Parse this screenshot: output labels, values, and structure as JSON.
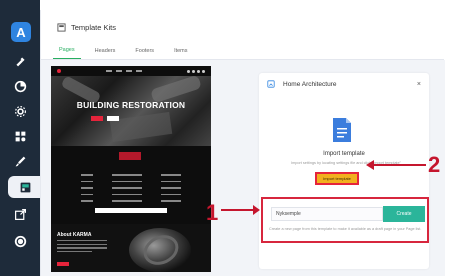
{
  "sidebar": {
    "logo_letter": "A",
    "items": [
      {
        "icon": "brush-icon"
      },
      {
        "icon": "pie-icon"
      },
      {
        "icon": "settings-icon"
      },
      {
        "icon": "blocks-icon"
      },
      {
        "icon": "paintbrush-icon"
      },
      {
        "icon": "template-icon",
        "active": true
      },
      {
        "icon": "export-icon"
      },
      {
        "icon": "avatar-icon"
      }
    ]
  },
  "header": {
    "title": "Template Kits"
  },
  "tabs": [
    {
      "label": "Pages",
      "active": true
    },
    {
      "label": "Headers"
    },
    {
      "label": "Footers"
    },
    {
      "label": "Items"
    }
  ],
  "preview": {
    "hero_title": "BUILDING RESTORATION",
    "about_title": "About KARMA"
  },
  "panel": {
    "title": "Home Architecture",
    "close": "×",
    "import_title": "Import template",
    "import_desc": "Import settings by locating settings file and click \"import template\"",
    "import_button": "Import template",
    "name_value": "Nyksemple",
    "create_button": "Create",
    "create_note": "Create a new page from this template to make it available as a draft page in your Page list."
  },
  "annotations": {
    "one": "1",
    "two": "2"
  },
  "colors": {
    "accent_green": "#27ae60",
    "create_teal": "#2bb59a",
    "import_yellow": "#f2b01e",
    "annotation_red": "#d7263d",
    "sidebar_dark": "#1e2b3a"
  }
}
